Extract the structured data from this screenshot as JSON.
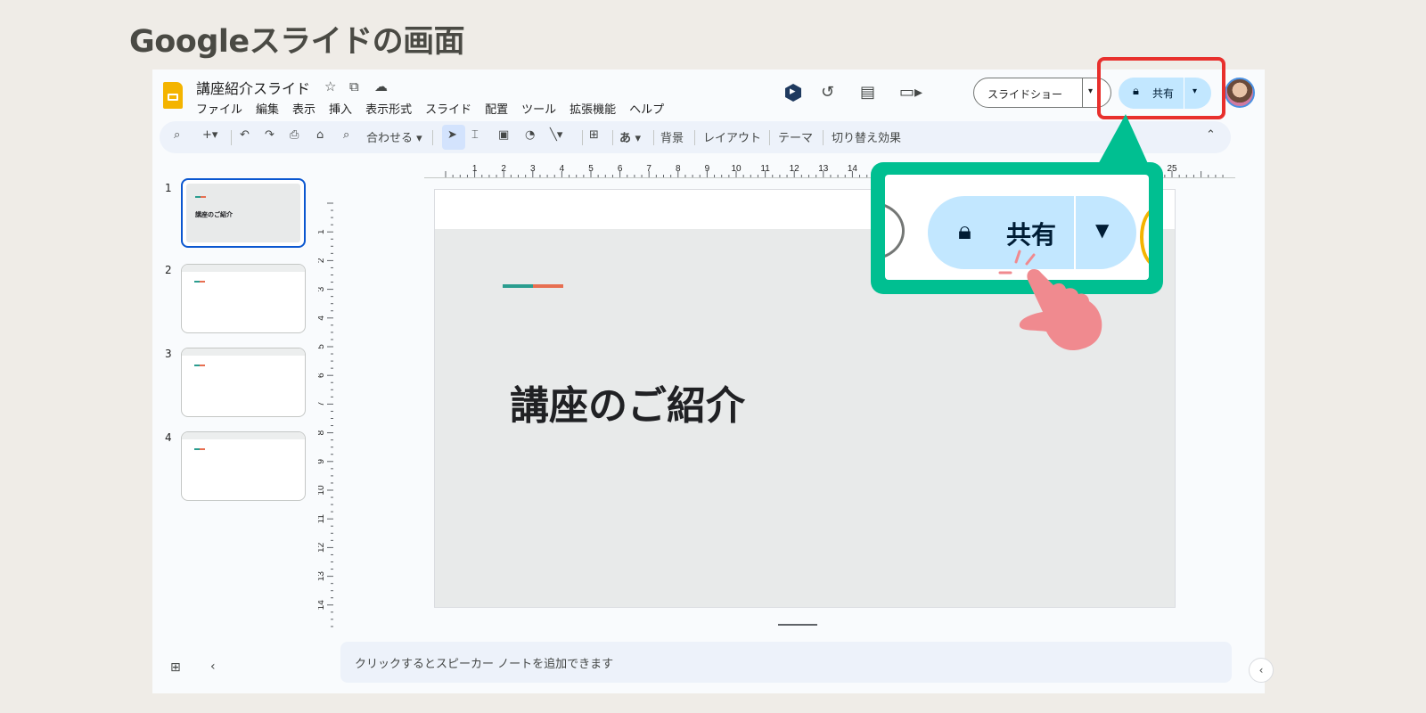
{
  "page_title": "Googleスライドの画面",
  "doc": {
    "title": "講座紹介スライド",
    "menu": [
      "ファイル",
      "編集",
      "表示",
      "挿入",
      "表示形式",
      "スライド",
      "配置",
      "ツール",
      "拡張機能",
      "ヘルプ"
    ]
  },
  "header_buttons": {
    "slideshow_label": "スライドショー",
    "share_label": "共有"
  },
  "toolbar": {
    "zoom_label": "合わせる",
    "font_glyph": "あ",
    "background_label": "背景",
    "layout_label": "レイアウト",
    "theme_label": "テーマ",
    "transition_label": "切り替え効果"
  },
  "filmstrip": {
    "slides": [
      {
        "number": "1",
        "title": "講座のご紹介"
      },
      {
        "number": "2"
      },
      {
        "number": "3"
      },
      {
        "number": "4"
      }
    ]
  },
  "ruler": {
    "horizontal": [
      "1",
      "2",
      "3",
      "4",
      "5",
      "6",
      "7",
      "8",
      "9",
      "10",
      "11",
      "12",
      "13",
      "14",
      "25"
    ],
    "vertical": [
      "1",
      "2",
      "3",
      "4",
      "5",
      "6",
      "7",
      "8",
      "9",
      "10",
      "11",
      "12",
      "13",
      "14"
    ]
  },
  "slide": {
    "title": "講座のご紹介"
  },
  "notes": {
    "placeholder": "クリックするとスピーカー ノートを追加できます"
  },
  "callout": {
    "share_label": "共有"
  },
  "colors": {
    "highlight_red": "#e8302d",
    "callout_green": "#00bf91",
    "share_blue": "#c2e7ff",
    "hand_pink": "#f08a8f"
  }
}
